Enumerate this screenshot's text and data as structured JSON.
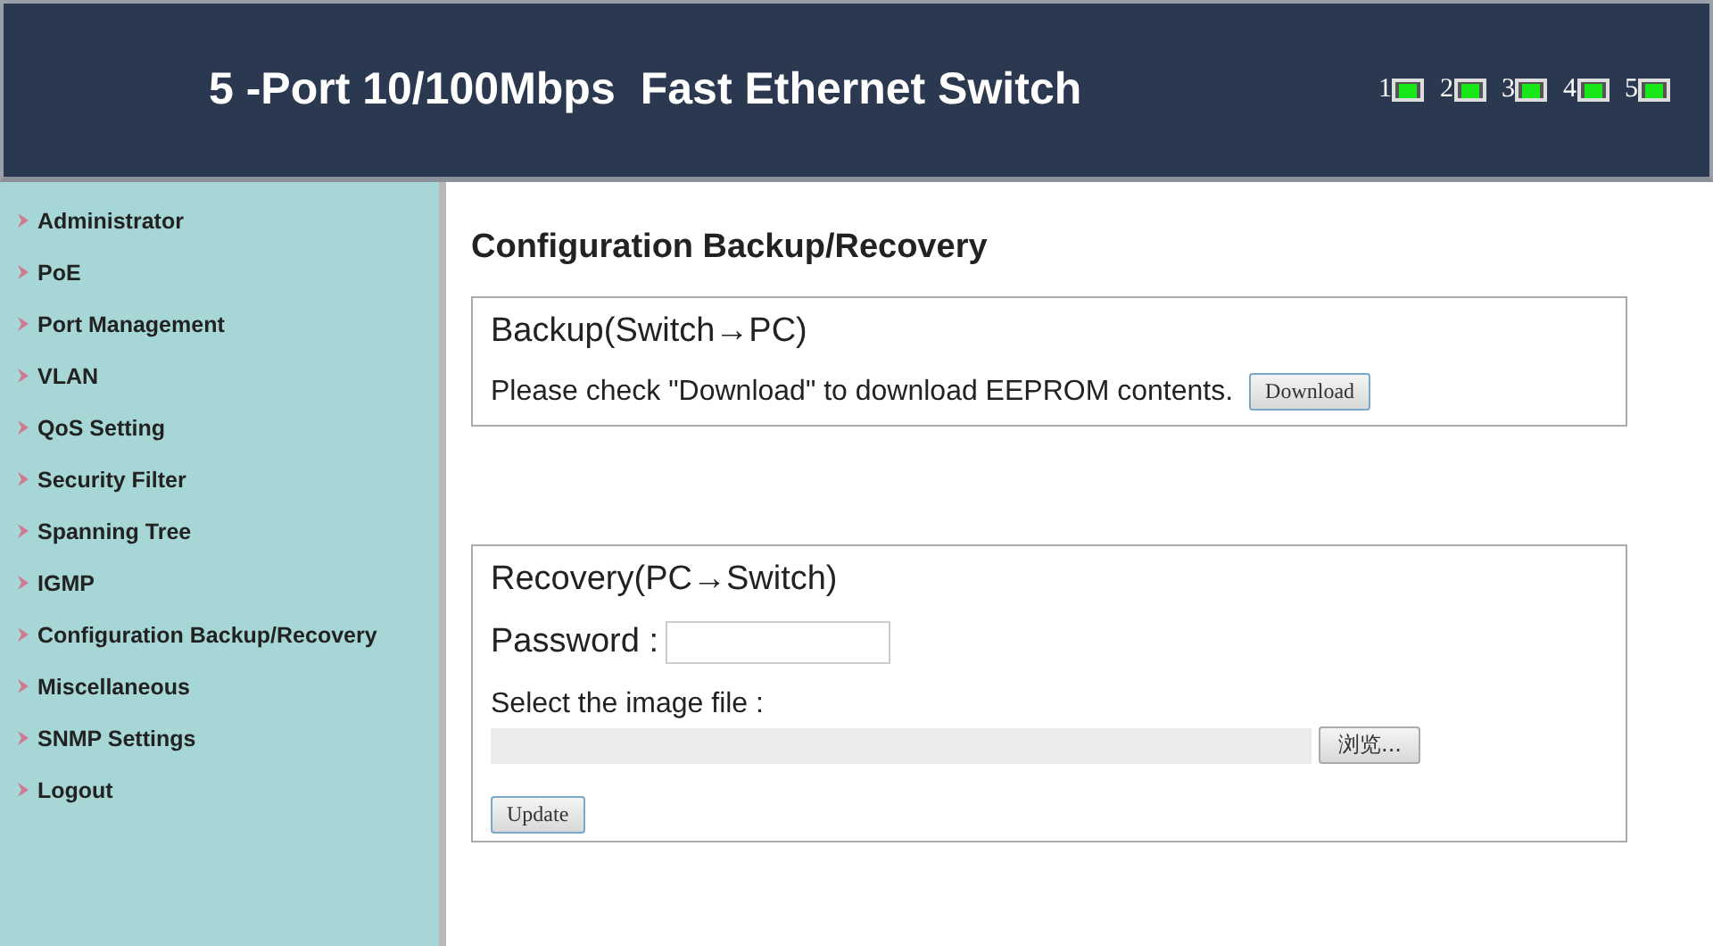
{
  "header": {
    "title": "5 -Port 10/100Mbps",
    "subtitle": "Fast Ethernet Switch",
    "ports": [
      {
        "label": "1",
        "link": true
      },
      {
        "label": "2",
        "link": true
      },
      {
        "label": "3",
        "link": true
      },
      {
        "label": "4",
        "link": true
      },
      {
        "label": "5",
        "link": true
      }
    ]
  },
  "sidebar": {
    "items": [
      "Administrator",
      "PoE",
      "Port Management",
      "VLAN",
      "QoS Setting",
      "Security Filter",
      "Spanning Tree",
      "IGMP",
      "Configuration Backup/Recovery",
      "Miscellaneous",
      "SNMP Settings",
      "Logout"
    ]
  },
  "page_title": "Configuration Backup/Recovery",
  "backup": {
    "heading": "Backup(Switch→PC)",
    "text": "Please check \"Download\" to download EEPROM contents.",
    "button": "Download"
  },
  "recovery": {
    "heading": "Recovery(PC→Switch)",
    "password_label": "Password :",
    "file_label": "Select the image file :",
    "browse_button": "浏览...",
    "update_button": "Update"
  }
}
